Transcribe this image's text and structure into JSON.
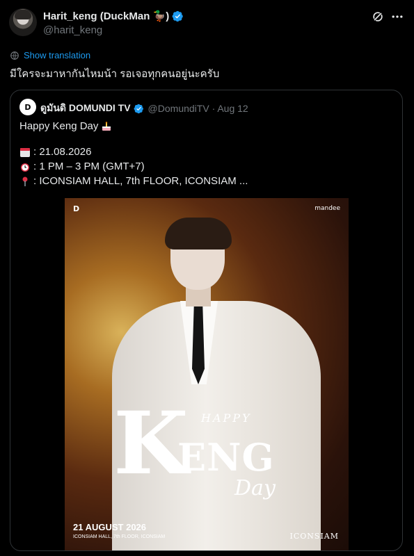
{
  "author": {
    "display_name": "Harit_keng (DuckMan 🦆)",
    "handle": "@harit_keng"
  },
  "translate": {
    "label": "Show translation"
  },
  "tweet": {
    "text": "มีใครจะมาหากันไหมน้า รอเจอทุกคนอยู่นะครับ"
  },
  "quote": {
    "avatar_text": "D",
    "display_name": "ดูมันดิ DOMUNDI TV",
    "meta": "@DomundiTV · Aug 12",
    "title": "Happy Keng Day",
    "date": ": 21.08.2026",
    "time": ": 1 PM – 3 PM (GMT+7)",
    "location": ": ICONSIAM HALL, 7th FLOOR, ICONSIAM ..."
  },
  "poster": {
    "logo_left": "D",
    "logo_right": "mandee",
    "happy": "HAPPY",
    "k": "K",
    "eng": "ENG",
    "day": "Day",
    "date": "21 AUGUST 2026",
    "venue": "ICONSIAM HALL, 7th FLOOR, ICONSIAM",
    "brand": "ICONSIAM"
  },
  "icons": [
    "grok-icon",
    "more-icon",
    "translate-icon",
    "verified-badge-icon",
    "cake-emoji",
    "calendar-emoji",
    "alarm-clock-emoji",
    "pin-emoji"
  ],
  "colors": {
    "background": "#000000",
    "text": "#e7e9ea",
    "muted": "#71767b",
    "link": "#1d9bf0",
    "verified": "#1d9bf0",
    "border": "#2f3336"
  }
}
